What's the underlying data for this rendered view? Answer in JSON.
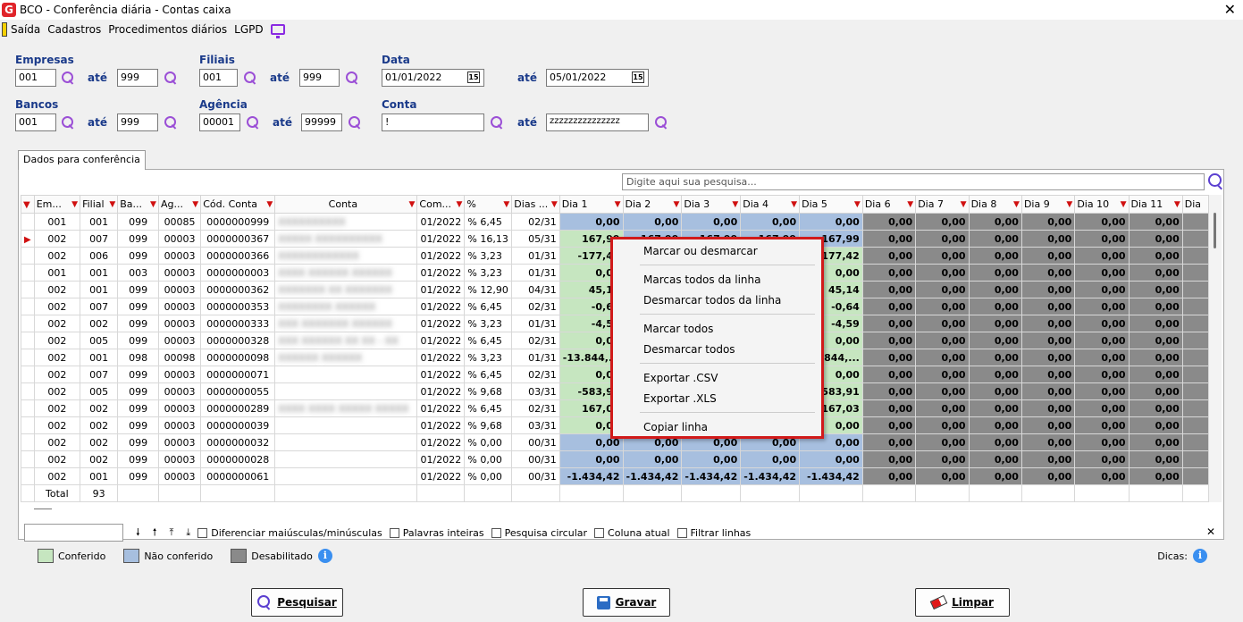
{
  "window": {
    "title": "BCO - Conferência diária - Contas caixa",
    "logo_letter": "G"
  },
  "menu": [
    "Saída",
    "Cadastros",
    "Procedimentos diários",
    "LGPD"
  ],
  "filters": {
    "empresas": {
      "label": "Empresas",
      "from": "001",
      "to": "999"
    },
    "filiais": {
      "label": "Filiais",
      "from": "001",
      "to": "999"
    },
    "data": {
      "label": "Data",
      "from": "01/01/2022",
      "to": "05/01/2022"
    },
    "bancos": {
      "label": "Bancos",
      "from": "001",
      "to": "999"
    },
    "agencia": {
      "label": "Agência",
      "from": "00001",
      "to": "99999"
    },
    "conta": {
      "label": "Conta",
      "from": "!",
      "to": "zzzzzzzzzzzzzzz"
    },
    "ate": "até",
    "cal_glyph": "15"
  },
  "tab_label": "Dados para conferência",
  "search_placeholder": "Digite aqui sua pesquisa...",
  "columns": [
    "Em...",
    "Filial",
    "Ba...",
    "Ag...",
    "Cód. Conta",
    "Conta",
    "Com...",
    "%",
    "Dias ...",
    "Dia 1",
    "Dia 2",
    "Dia 3",
    "Dia 4",
    "Dia 5",
    "Dia 6",
    "Dia 7",
    "Dia 8",
    "Dia 9",
    "Dia 10",
    "Dia 11",
    "Dia"
  ],
  "rows": [
    [
      "001",
      "001",
      "099",
      "00085",
      "0000000999",
      "XXXXXXXXXX",
      "01/2022",
      "% 6,45",
      "02/31",
      "0,00",
      "0,00",
      "0,00",
      "0,00",
      "0,00"
    ],
    [
      "002",
      "007",
      "099",
      "00003",
      "0000000367",
      "XXXXX XXXXXXXXXX",
      "01/2022",
      "% 16,13",
      "05/31",
      "167,99",
      "167,99",
      "167,99",
      "167,99",
      "167,99"
    ],
    [
      "002",
      "006",
      "099",
      "00003",
      "0000000366",
      "XXXXXXXXXXXX",
      "01/2022",
      "% 3,23",
      "01/31",
      "-177,42",
      "",
      "",
      "",
      "-177,42"
    ],
    [
      "001",
      "001",
      "003",
      "00003",
      "0000000003",
      "XXXX XXXXXX XXXXXX",
      "01/2022",
      "% 3,23",
      "01/31",
      "0,00",
      "",
      "",
      "",
      "0,00"
    ],
    [
      "002",
      "001",
      "099",
      "00003",
      "0000000362",
      "XXXXXXX XX XXXXXXX",
      "01/2022",
      "% 12,90",
      "04/31",
      "45,14",
      "",
      "",
      "",
      "45,14"
    ],
    [
      "002",
      "007",
      "099",
      "00003",
      "0000000353",
      "XXXXXXXX XXXXXX",
      "01/2022",
      "% 6,45",
      "02/31",
      "-0,64",
      "",
      "",
      "",
      "-0,64"
    ],
    [
      "002",
      "002",
      "099",
      "00003",
      "0000000333",
      "XXX XXXXXXX XXXXXX",
      "01/2022",
      "% 3,23",
      "01/31",
      "-4,59",
      "",
      "",
      "",
      "-4,59"
    ],
    [
      "002",
      "005",
      "099",
      "00003",
      "0000000328",
      "XXX XXXXXX XX XX - XX",
      "01/2022",
      "% 6,45",
      "02/31",
      "0,00",
      "",
      "",
      "",
      "0,00"
    ],
    [
      "002",
      "001",
      "098",
      "00098",
      "0000000098",
      "XXXXXX XXXXXX",
      "01/2022",
      "% 3,23",
      "01/31",
      "-13.844,...",
      "",
      "",
      "",
      "-13.844,..."
    ],
    [
      "002",
      "007",
      "099",
      "00003",
      "0000000071",
      "",
      "01/2022",
      "% 6,45",
      "02/31",
      "0,00",
      "",
      "",
      "",
      "0,00"
    ],
    [
      "002",
      "005",
      "099",
      "00003",
      "0000000055",
      "",
      "01/2022",
      "% 9,68",
      "03/31",
      "-583,91",
      "",
      "",
      "",
      "-583,91"
    ],
    [
      "002",
      "002",
      "099",
      "00003",
      "0000000289",
      "XXXX XXXX XXXXX XXXXX",
      "01/2022",
      "% 6,45",
      "02/31",
      "167,03",
      "",
      "",
      "",
      "167,03"
    ],
    [
      "002",
      "002",
      "099",
      "00003",
      "0000000039",
      "",
      "01/2022",
      "% 9,68",
      "03/31",
      "0,00",
      "",
      "",
      "",
      "0,00"
    ],
    [
      "002",
      "002",
      "099",
      "00003",
      "0000000032",
      "",
      "01/2022",
      "% 0,00",
      "00/31",
      "0,00",
      "0,00",
      "0,00",
      "0,00",
      "0,00"
    ],
    [
      "002",
      "002",
      "099",
      "00003",
      "0000000028",
      "",
      "01/2022",
      "% 0,00",
      "00/31",
      "0,00",
      "0,00",
      "0,00",
      "0,00",
      "0,00"
    ],
    [
      "002",
      "001",
      "099",
      "00003",
      "0000000061",
      "",
      "01/2022",
      "% 0,00",
      "00/31",
      "-1.434,42",
      "-1.434,42",
      "-1.434,42",
      "-1.434,42",
      "-1.434,42"
    ]
  ],
  "disabled_value": "0,00",
  "total": {
    "label": "Total",
    "count": "93"
  },
  "context_menu": [
    "Marcar ou desmarcar",
    "Marcas todos da linha",
    "Desmarcar todos da linha",
    "Marcar todos",
    "Desmarcar todos",
    "Exportar .CSV",
    "Exportar .XLS",
    "Copiar linha"
  ],
  "search_options": [
    "Diferenciar maiúsculas/minúsculas",
    "Palavras inteiras",
    "Pesquisa circular",
    "Coluna atual",
    "Filtrar linhas"
  ],
  "legend": {
    "conferido": "Conferido",
    "nao_conferido": "Não conferido",
    "desabilitado": "Desabilitado"
  },
  "colors": {
    "conferido": "#c6e6c0",
    "nao_conferido": "#a7bfdf",
    "desabilitado": "#8a8a8a",
    "accent_red": "#d11a1a"
  },
  "dicas": "Dicas:",
  "buttons": {
    "pesquisar": "Pesquisar",
    "gravar": "Gravar",
    "limpar": "Limpar"
  }
}
